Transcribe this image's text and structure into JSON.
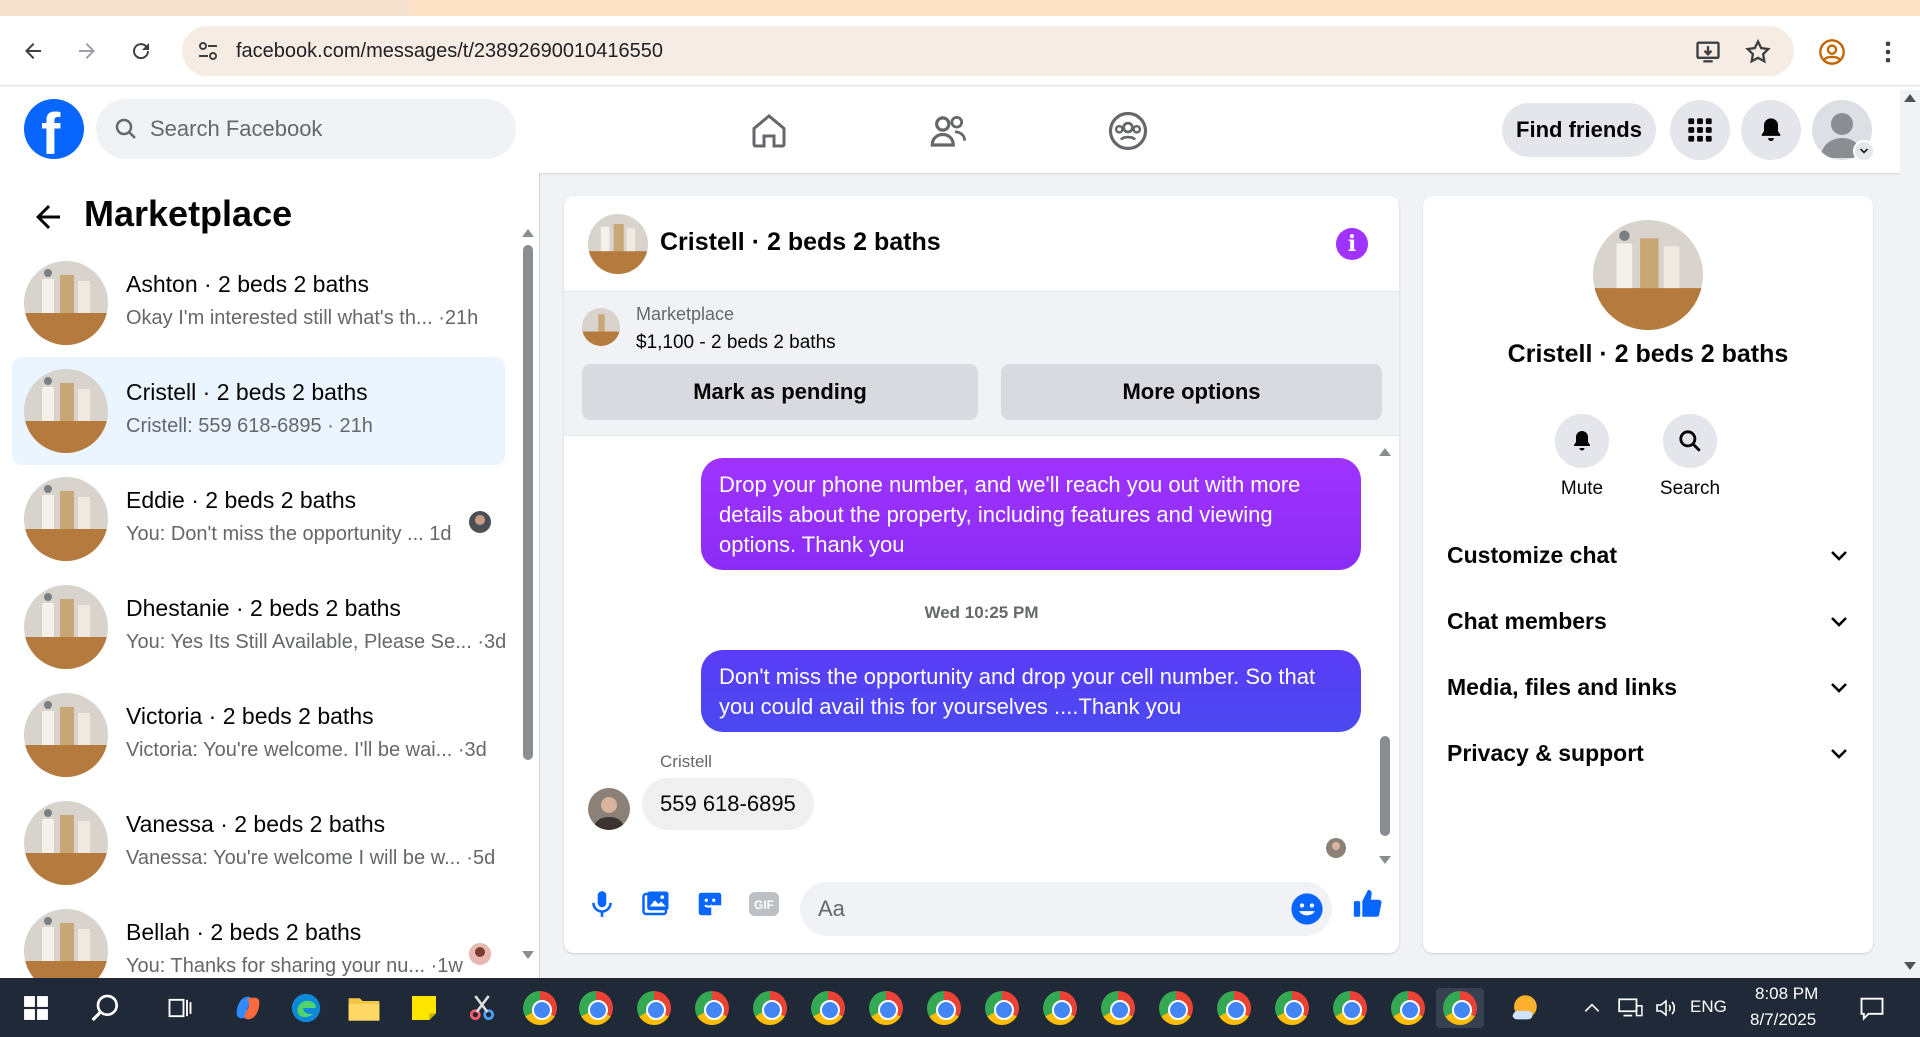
{
  "browser": {
    "url": "facebook.com/messages/t/23892690010416550"
  },
  "header": {
    "logo_letter": "f",
    "search_placeholder": "Search Facebook",
    "find_friends": "Find friends"
  },
  "sidebar": {
    "title": "Marketplace",
    "conversations": [
      {
        "name": "Ashton · 2 beds 2 baths",
        "preview": "Okay I'm interested still what's th... ·21h",
        "active": false
      },
      {
        "name": "Cristell · 2 beds 2 baths",
        "preview": "Cristell: 559 618-6895 · 21h",
        "active": true
      },
      {
        "name": "Eddie · 2 beds 2 baths",
        "preview": "You: Don't miss the opportunity ...   1d",
        "active": false
      },
      {
        "name": "Dhestanie · 2 beds 2 baths",
        "preview": "You: Yes Its Still Available, Please Se... ·3d",
        "active": false
      },
      {
        "name": "Victoria · 2 beds 2 baths",
        "preview": "Victoria: You're welcome. I'll be wai... ·3d",
        "active": false
      },
      {
        "name": "Vanessa · 2 beds 2 baths",
        "preview": "Vanessa: You're welcome I will be w... ·5d",
        "active": false
      },
      {
        "name": "Bellah · 2 beds 2 baths",
        "preview": "You: Thanks for sharing your nu... ·1w",
        "active": false
      }
    ]
  },
  "chat": {
    "title": "Cristell · 2 beds 2 baths",
    "info_glyph": "i",
    "listing": {
      "label": "Marketplace",
      "price": "$1,100 - 2 beds 2 baths",
      "mark_pending": "Mark as pending",
      "more_options": "More options"
    },
    "messages": [
      {
        "from": "me",
        "text": "Drop your phone number, and we'll reach you out with more details about the property, including features and viewing options.  Thank you"
      },
      {
        "from": "me",
        "text": "Don't miss the opportunity and drop your cell number. So that you could  avail this for yourselves ....Thank you"
      },
      {
        "from": "Cristell",
        "text": "559 618-6895"
      }
    ],
    "timestamp": "Wed 10:25 PM",
    "sender_name": "Cristell",
    "composer_placeholder": "Aa"
  },
  "info_panel": {
    "name": "Cristell · 2 beds 2 baths",
    "mute": "Mute",
    "search": "Search",
    "sections": [
      "Customize chat",
      "Chat members",
      "Media, files and links",
      "Privacy & support"
    ]
  },
  "taskbar": {
    "language": "ENG",
    "time": "8:08 PM",
    "date": "8/7/2025"
  },
  "colors": {
    "fb_blue": "#0866ff",
    "bubble_purple": "#a033ff",
    "bubble_indigo": "#4a49f0",
    "active_row": "#ebf5ff"
  }
}
